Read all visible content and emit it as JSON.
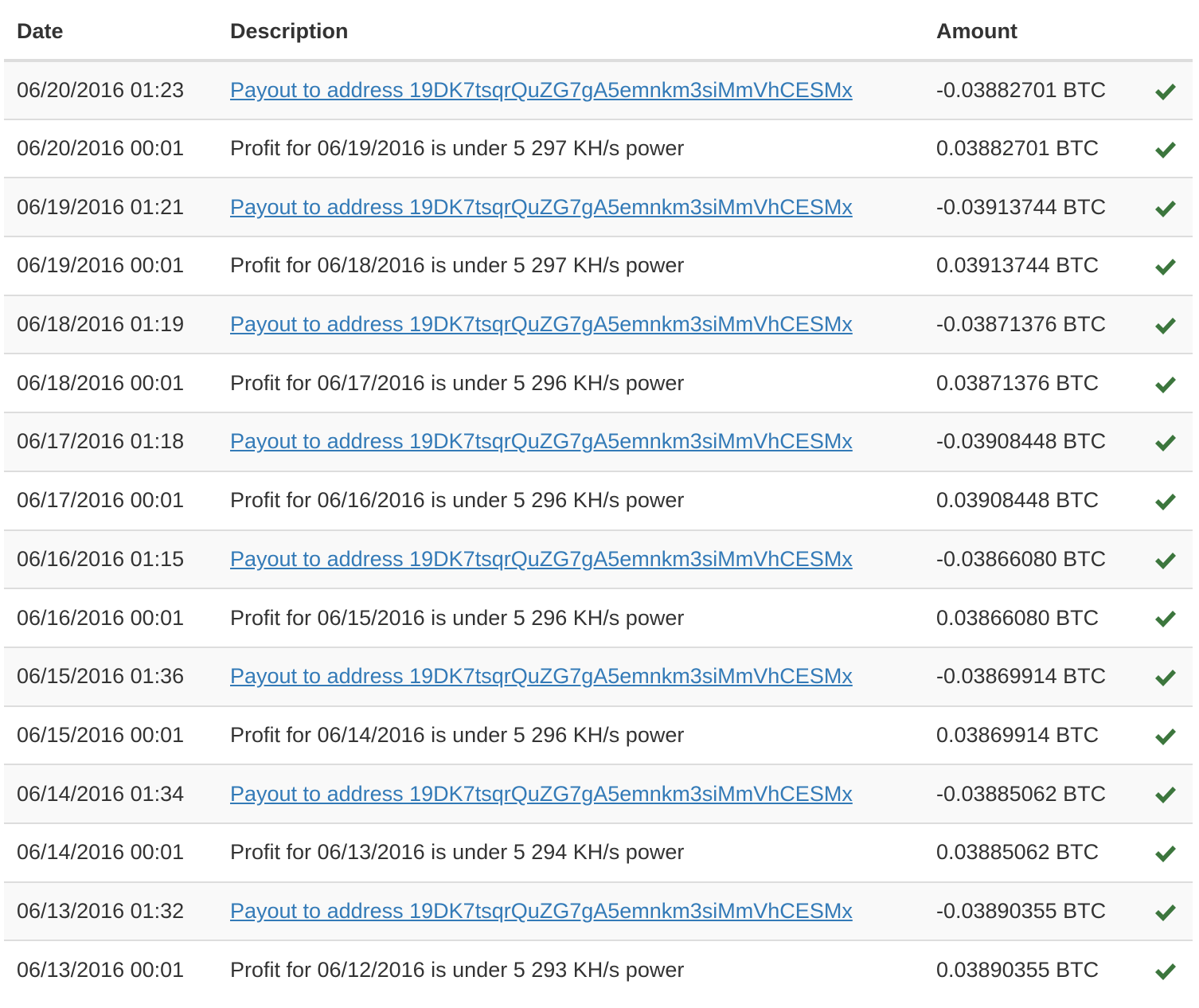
{
  "table": {
    "headers": {
      "date": "Date",
      "description": "Description",
      "amount": "Amount"
    },
    "status_icon": "check-icon",
    "status_color": "#3c763d",
    "link_color": "#337ab7",
    "rows": [
      {
        "date": "06/20/2016 01:23",
        "type": "payout",
        "description": "Payout to address 19DK7tsqrQuZG7gA5emnkm3siMmVhCESMx",
        "amount": "-0.03882701 BTC"
      },
      {
        "date": "06/20/2016 00:01",
        "type": "profit",
        "description": "Profit for 06/19/2016 is under 5 297 KH/s power",
        "amount": "0.03882701 BTC"
      },
      {
        "date": "06/19/2016 01:21",
        "type": "payout",
        "description": "Payout to address 19DK7tsqrQuZG7gA5emnkm3siMmVhCESMx",
        "amount": "-0.03913744 BTC"
      },
      {
        "date": "06/19/2016 00:01",
        "type": "profit",
        "description": "Profit for 06/18/2016 is under 5 297 KH/s power",
        "amount": "0.03913744 BTC"
      },
      {
        "date": "06/18/2016 01:19",
        "type": "payout",
        "description": "Payout to address 19DK7tsqrQuZG7gA5emnkm3siMmVhCESMx",
        "amount": "-0.03871376 BTC"
      },
      {
        "date": "06/18/2016 00:01",
        "type": "profit",
        "description": "Profit for 06/17/2016 is under 5 296 KH/s power",
        "amount": "0.03871376 BTC"
      },
      {
        "date": "06/17/2016 01:18",
        "type": "payout",
        "description": "Payout to address 19DK7tsqrQuZG7gA5emnkm3siMmVhCESMx",
        "amount": "-0.03908448 BTC"
      },
      {
        "date": "06/17/2016 00:01",
        "type": "profit",
        "description": "Profit for 06/16/2016 is under 5 296 KH/s power",
        "amount": "0.03908448 BTC"
      },
      {
        "date": "06/16/2016 01:15",
        "type": "payout",
        "description": "Payout to address 19DK7tsqrQuZG7gA5emnkm3siMmVhCESMx",
        "amount": "-0.03866080 BTC"
      },
      {
        "date": "06/16/2016 00:01",
        "type": "profit",
        "description": "Profit for 06/15/2016 is under 5 296 KH/s power",
        "amount": "0.03866080 BTC"
      },
      {
        "date": "06/15/2016 01:36",
        "type": "payout",
        "description": "Payout to address 19DK7tsqrQuZG7gA5emnkm3siMmVhCESMx",
        "amount": "-0.03869914 BTC"
      },
      {
        "date": "06/15/2016 00:01",
        "type": "profit",
        "description": "Profit for 06/14/2016 is under 5 296 KH/s power",
        "amount": "0.03869914 BTC"
      },
      {
        "date": "06/14/2016 01:34",
        "type": "payout",
        "description": "Payout to address 19DK7tsqrQuZG7gA5emnkm3siMmVhCESMx",
        "amount": "-0.03885062 BTC"
      },
      {
        "date": "06/14/2016 00:01",
        "type": "profit",
        "description": "Profit for 06/13/2016 is under 5 294 KH/s power",
        "amount": "0.03885062 BTC"
      },
      {
        "date": "06/13/2016 01:32",
        "type": "payout",
        "description": "Payout to address 19DK7tsqrQuZG7gA5emnkm3siMmVhCESMx",
        "amount": "-0.03890355 BTC"
      },
      {
        "date": "06/13/2016 00:01",
        "type": "profit",
        "description": "Profit for 06/12/2016 is under 5 293 KH/s power",
        "amount": "0.03890355 BTC"
      }
    ]
  }
}
